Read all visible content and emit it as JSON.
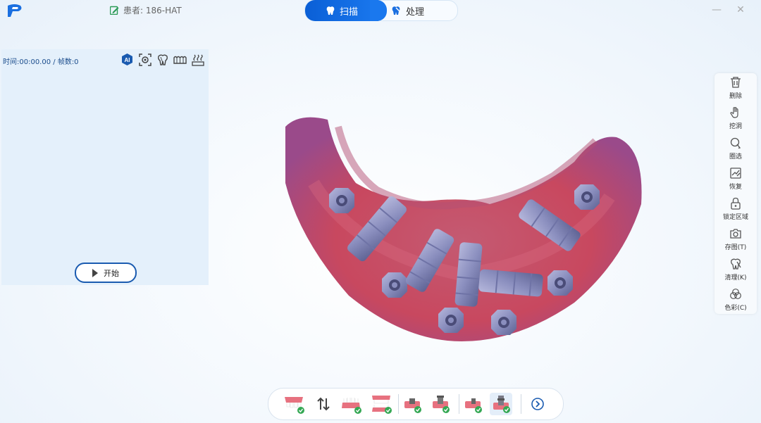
{
  "header": {
    "patient_label": "患者: 186-HAT",
    "tabs": [
      {
        "label": "扫描",
        "active": true
      },
      {
        "label": "处理",
        "active": false
      }
    ],
    "minimize_symbol": "—",
    "close_symbol": "✕"
  },
  "left_panel": {
    "timer_text": "时间:00:00.00 / 帧数:0",
    "ai_badge": "AI",
    "start_label": "开始"
  },
  "right_toolbar": {
    "items": [
      {
        "label": "删除",
        "icon": "trash-icon"
      },
      {
        "label": "挖洞",
        "icon": "dig-hole-icon"
      },
      {
        "label": "圈选",
        "icon": "lasso-select-icon"
      },
      {
        "label": "恢复",
        "icon": "restore-icon"
      },
      {
        "label": "锁定区域",
        "icon": "lock-icon"
      },
      {
        "label": "存图(T)",
        "icon": "camera-icon"
      },
      {
        "label": "清理(K)",
        "icon": "clean-icon"
      },
      {
        "label": "色彩(C)",
        "icon": "color-icon"
      }
    ]
  },
  "bottom_toolbar": {
    "active_index": 7
  },
  "colors": {
    "accent": "#1a6fe0",
    "gum": "#c84a6a",
    "scanbody": "#8a8fbe"
  }
}
